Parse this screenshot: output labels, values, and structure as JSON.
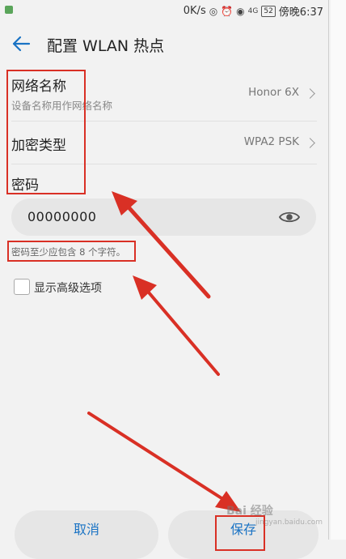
{
  "status_bar": {
    "speed": "0K/s",
    "signal_type": "4G",
    "battery": "52",
    "time": "傍晚6:37"
  },
  "header": {
    "title": "配置 WLAN 热点"
  },
  "network_name": {
    "label": "网络名称",
    "sub": "设备名称用作网络名称",
    "value": "Honor 6X"
  },
  "encryption": {
    "label": "加密类型",
    "value": "WPA2 PSK"
  },
  "password": {
    "label": "密码",
    "value": "00000000",
    "hint": "密码至少应包含 8 个字符。"
  },
  "advanced": {
    "label": "显示高级选项",
    "checked": false
  },
  "buttons": {
    "cancel": "取消",
    "save": "保存"
  },
  "watermark": {
    "text": "Bai 经验",
    "url": "jingyan.baidu.com"
  },
  "colors": {
    "accent": "#1a73c4",
    "annotation": "#d93025"
  },
  "icons": [
    "back-arrow-icon",
    "chevron-right-icon",
    "eye-icon",
    "wifi-icon",
    "alarm-icon"
  ]
}
